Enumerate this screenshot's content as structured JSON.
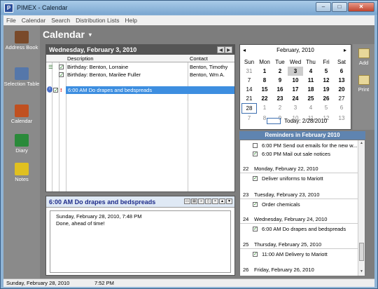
{
  "window": {
    "title": "PIMEX - Calendar",
    "icon_letter": "P"
  },
  "menu": [
    "File",
    "Calendar",
    "Search",
    "Distribution Lists",
    "Help"
  ],
  "sidebar": [
    {
      "label": "Address Book",
      "icon": "address-book-icon",
      "color": "#7a4a2a"
    },
    {
      "label": "Selection Table",
      "icon": "selection-table-icon",
      "color": "#5577aa"
    },
    {
      "label": "Calendar",
      "icon": "calendar-icon",
      "color": "#c05020"
    },
    {
      "label": "Diary",
      "icon": "diary-icon",
      "color": "#2a8a3a"
    },
    {
      "label": "Notes",
      "icon": "notes-icon",
      "color": "#e0c020"
    }
  ],
  "header": {
    "title": "Calendar",
    "caret": "▾"
  },
  "day": {
    "date": "Wednesday, February 3, 2010",
    "columns": {
      "description": "Description",
      "contact": "Contact"
    },
    "rows": [
      {
        "flag": "",
        "desc": "Birthday: Benton, Lorraine",
        "contact": "Benton, Timothy"
      },
      {
        "flag": "",
        "desc": "Birthday: Benton, Marilee Fuller",
        "contact": "Benton, Wm A."
      },
      {
        "flag": "!",
        "desc": "6:00 AM  Do drapes and bedspreads",
        "contact": ""
      }
    ]
  },
  "note": {
    "title": "6:00 AM  Do drapes and bedspreads",
    "line1": "Sunday, February 28, 2010, 7:48 PM",
    "line2": "Done, ahead of time!"
  },
  "minical": {
    "month": "February, 2010",
    "prev": "◂",
    "next": "▸",
    "weekdays": [
      "Sun",
      "Mon",
      "Tue",
      "Wed",
      "Thu",
      "Fri",
      "Sat"
    ],
    "weeks": [
      [
        "31",
        "1",
        "2",
        "3",
        "4",
        "5",
        "6"
      ],
      [
        "7",
        "8",
        "9",
        "10",
        "11",
        "12",
        "13"
      ],
      [
        "14",
        "15",
        "16",
        "17",
        "18",
        "19",
        "20"
      ],
      [
        "21",
        "22",
        "23",
        "24",
        "25",
        "26",
        "27"
      ],
      [
        "28",
        "1",
        "2",
        "3",
        "4",
        "5",
        "6"
      ],
      [
        "7",
        "8",
        "9",
        "10",
        "11",
        "12",
        "13"
      ]
    ],
    "today_label": "Today: 2/28/2010"
  },
  "actions": [
    {
      "label": "Add"
    },
    {
      "label": "Print"
    }
  ],
  "reminders": {
    "title": "Reminders in February 2010",
    "items": [
      {
        "type": "item",
        "checked": false,
        "text": "6:00 PM  Send out emails for the new w..."
      },
      {
        "type": "item",
        "checked": true,
        "text": "6:00 PM  Mail out sale notices"
      },
      {
        "type": "date",
        "day": "22",
        "text": "Monday, February 22, 2010"
      },
      {
        "type": "item",
        "checked": true,
        "text": "Deliver uniforms to Mariott"
      },
      {
        "type": "date",
        "day": "23",
        "text": "Tuesday, February 23, 2010"
      },
      {
        "type": "item",
        "checked": true,
        "text": "Order chemicals"
      },
      {
        "type": "date",
        "day": "24",
        "text": "Wednesday, February 24, 2010"
      },
      {
        "type": "item",
        "checked": true,
        "text": "6:00 AM  Do drapes and bedspreads"
      },
      {
        "type": "date",
        "day": "25",
        "text": "Thursday, February 25, 2010"
      },
      {
        "type": "item",
        "checked": true,
        "text": "11:00 AM  Delivery to Mariott"
      },
      {
        "type": "date",
        "day": "26",
        "text": "Friday, February 26, 2010"
      }
    ]
  },
  "status": {
    "date": "Sunday, February 28, 2010",
    "time": "7:52 PM"
  }
}
